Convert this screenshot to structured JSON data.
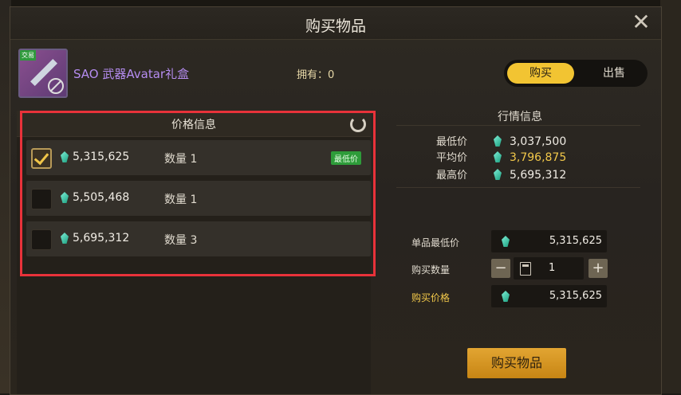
{
  "dialog": {
    "title": "购买物品"
  },
  "item": {
    "name": "SAO 武器Avatar礼盒",
    "badge": "交易",
    "owned_label": "拥有：",
    "owned_count": "0"
  },
  "mode_toggle": {
    "buy": "购买",
    "sell": "出售"
  },
  "price_info": {
    "title": "价格信息",
    "rows": [
      {
        "price": "5,315,625",
        "qty": "数量 1",
        "badge": "最低价",
        "selected": true
      },
      {
        "price": "5,505,468",
        "qty": "数量 1",
        "badge": "",
        "selected": false
      },
      {
        "price": "5,695,312",
        "qty": "数量 3",
        "badge": "",
        "selected": false
      }
    ]
  },
  "market": {
    "title": "行情信息",
    "lowest_label": "最低价",
    "lowest": "3,037,500",
    "avg_label": "平均价",
    "avg": "3,796,875",
    "highest_label": "最高价",
    "highest": "5,695,312"
  },
  "purchase": {
    "unit_label": "单品最低价",
    "unit_value": "5,315,625",
    "qty_label": "购买数量",
    "qty_value": "1",
    "total_label": "购买价格",
    "total_value": "5,315,625",
    "button": "购买物品"
  },
  "colors": {
    "accent": "#f2c432",
    "highlight_box": "#e8323a",
    "item_name": "#b58cf0"
  }
}
